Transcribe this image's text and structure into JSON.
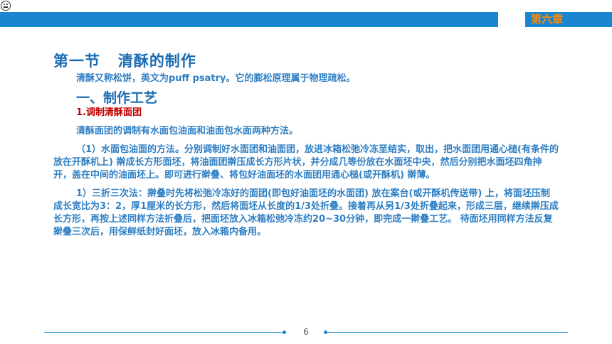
{
  "header": {
    "chapter_label": "第六章"
  },
  "section": {
    "title": "第一节   清酥的制作",
    "intro": "清酥又称松饼，英文为puff psatry。它的膨松原理属于物理疏松。",
    "subheading": "一、制作工艺",
    "item_heading": "1.调制清酥面团",
    "methods_text": "清酥面团的调制有水面包油面和油面包水面两种方法。",
    "paragraph1": "（1）水面包油面的方法。分别调制好水面团和油面团，放进冰箱松弛冷冻至结实，取出，把水面团用通心槌(有条件的放在开酥机上) 擀成长方形面坯，将油面团擀压成长方形片状，并分成几等份放在水面坯中央，然后分别把水面坯四角抻开，盖在中间的油面坯上。即可进行擀叠、将包好油面坯的水面团用通心槌(或开酥机) 擀薄。",
    "paragraph2": "1）三折三次法：擀叠时先将松弛冷冻好的面团(即包好油面坯的水面团) 放在案台(或开酥机传送带) 上，将面坯压制成长宽比为3：2，厚1厘米的长方形，然后将面坯从长度的1/3处折叠。接着再从另1/3处折叠起来，形成三层，继续擀压成长方形，再按上述同样方法折叠后，把面坯放入冰箱松弛冷冻约20~30分钟，即完成一擀叠工艺。 待面坯用同样方法反复擀叠三次后，用保鲜纸封好面坯，放入冰箱内备用。"
  },
  "footer": {
    "page_number": "6"
  }
}
